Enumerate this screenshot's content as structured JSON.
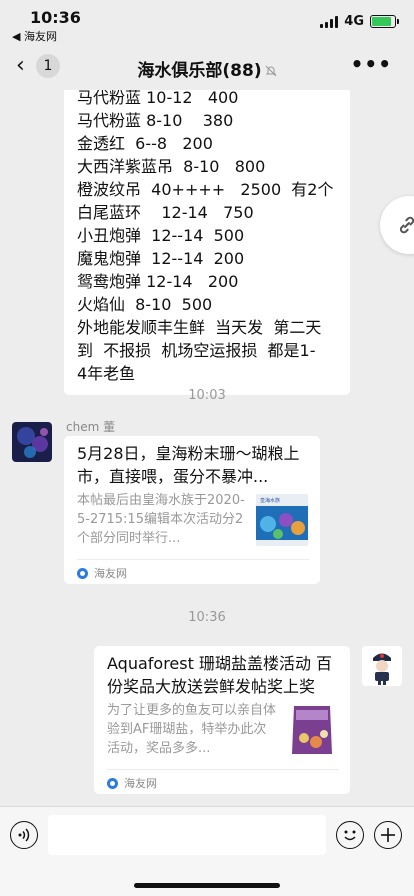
{
  "status_bar": {
    "time": "10:36",
    "back_app": "◀ 海友网",
    "network": "4G",
    "battery_level": 0.85
  },
  "nav": {
    "back_icon": "‹",
    "unread_count": "1",
    "title": "海水俱乐部(88)",
    "mute_icon": "muted-bell-icon",
    "more_icon": "•••"
  },
  "messages": {
    "price_list": {
      "lines": [
        "马代粉蓝 10-12   400",
        "马代粉蓝 8-10    380",
        "金透红  6--8   200",
        "大西洋紫蓝吊  8-10   800",
        "橙波纹吊  40++++   2500  有2个",
        "白尾蓝环    12-14   750",
        "小丑炮弹  12--14  500",
        "魔鬼炮弹  12--14  200",
        "鸳鸯炮弹 12-14   200",
        "火焰仙  8-10  500",
        "外地能发顺丰生鲜  当天发  第二天",
        "到  不报损  机场空运报损  都是1-",
        "4年老鱼"
      ]
    },
    "time_1": "10:03",
    "card_1": {
      "sender": "chem 董",
      "title": "5月28日，皇海粉末珊～瑚粮上市，直接喂，蛋分不暴冲...",
      "desc": "本帖最后由皇海水族于2020-5-2715:15编辑本次活动分2个部分同时举行...",
      "thumb_caption": "皇海水族",
      "source": "海友网"
    },
    "time_2": "10:36",
    "card_2": {
      "title": "Aquaforest 珊瑚盐盖楼活动 百份奖品大放送尝鲜发帖奖上奖",
      "desc": "为了让更多的鱼友可以亲自体验到AF珊瑚盐，特举办此次活动，奖品多多...",
      "source": "海友网"
    }
  },
  "colors": {
    "background": "#ededed",
    "bubble": "#ffffff",
    "timestamp": "#999999",
    "battery": "#34c759"
  }
}
